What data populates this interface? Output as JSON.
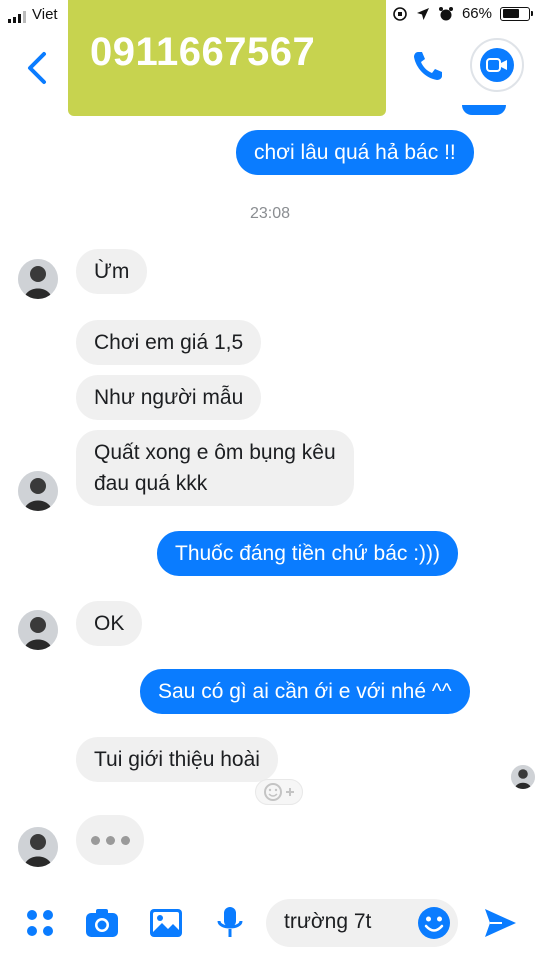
{
  "status_bar": {
    "carrier": "Viet",
    "battery_percent": "66%",
    "battery_level": 0.66
  },
  "overlay": {
    "phone_number": "0911667567"
  },
  "messages": {
    "m1": "chơi lâu quá hả bác !!",
    "timestamp": "23:08",
    "m2": "Ừm",
    "m3": "Chơi em giá 1,5",
    "m4": "Như người mẫu",
    "m5_line1": "Quất xong e ôm bụng kêu",
    "m5_line2": "đau quá kkk",
    "m6": "Thuốc đáng tiền chứ bác :)))",
    "m7": "OK",
    "m8": "Sau có gì ai cần ới e với nhé ^^",
    "m9": "Tui giới thiệu hoài"
  },
  "composer": {
    "input_value": "trường 7t"
  },
  "colors": {
    "accent": "#0a7cff",
    "incoming_bubble": "#f0f0f0",
    "overlay": "#c7d34f"
  },
  "icons": [
    "back-chevron-icon",
    "phone-icon",
    "video-icon",
    "apps-icon",
    "camera-icon",
    "image-icon",
    "microphone-icon",
    "emoji-icon",
    "send-icon",
    "add-reaction-icon"
  ]
}
